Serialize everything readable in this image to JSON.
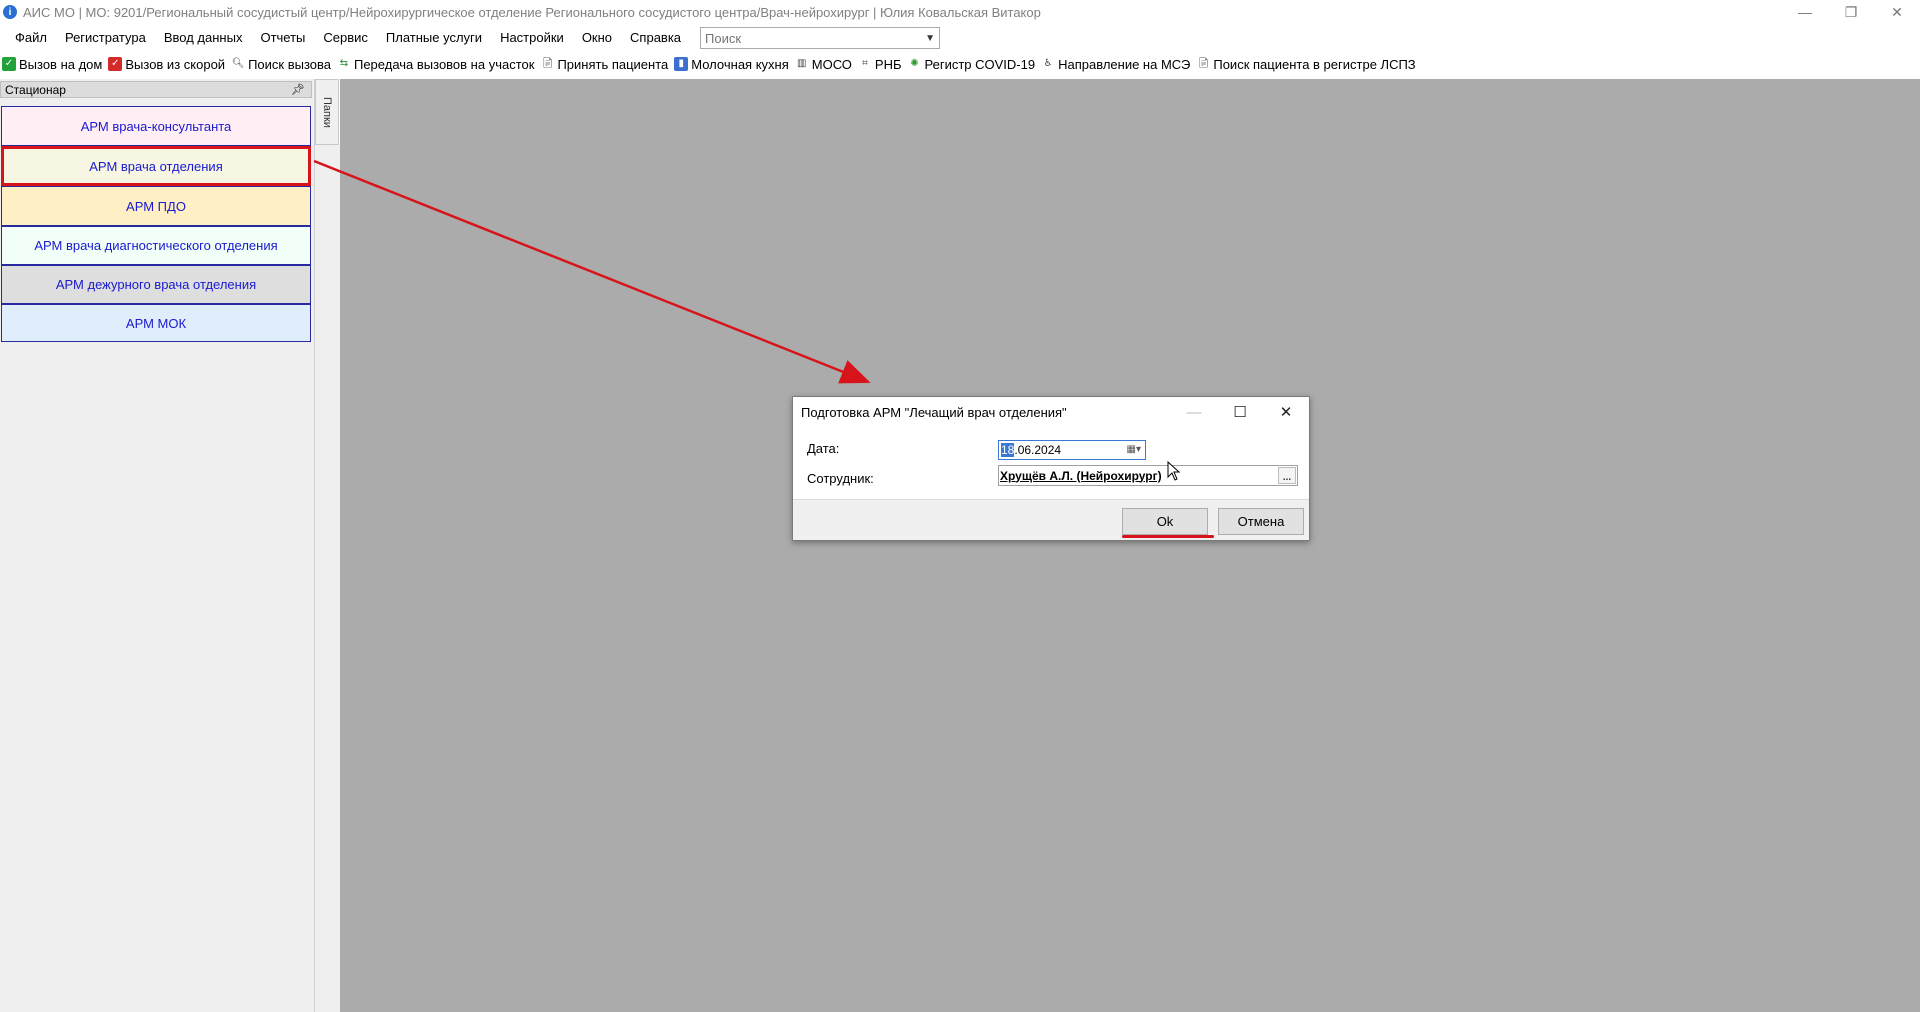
{
  "window": {
    "title": "АИС МО | МО: 9201/Региональный сосудистый центр/Нейрохирургическое отделение Регионального сосудистого центра/Врач-нейрохирург | Юлия Ковальская Витакор",
    "minimize": "—",
    "restore": "❐",
    "close": "✕"
  },
  "menu": {
    "items": [
      "Файл",
      "Регистратура",
      "Ввод данных",
      "Отчеты",
      "Сервис",
      "Платные услуги",
      "Настройки",
      "Окно",
      "Справка"
    ],
    "search_placeholder": "Поиск"
  },
  "toolbar": {
    "items": [
      {
        "label": "Вызов на дом",
        "icon": "check-green-icon"
      },
      {
        "label": "Вызов из скорой",
        "icon": "check-red-icon"
      },
      {
        "label": "Поиск вызова",
        "icon": "search-icon"
      },
      {
        "label": "Передача вызовов на участок",
        "icon": "transfer-icon"
      },
      {
        "label": "Принять пациента",
        "icon": "document-icon"
      },
      {
        "label": "Молочная кухня",
        "icon": "bottle-icon"
      },
      {
        "label": "МОСО",
        "icon": "building-icon"
      },
      {
        "label": "РНБ",
        "icon": "tag-icon"
      },
      {
        "label": "Регистр COVID-19",
        "icon": "virus-icon"
      },
      {
        "label": "Направление на МСЭ",
        "icon": "wheelchair-icon"
      },
      {
        "label": "Поиск пациента в регистре ЛСПЗ",
        "icon": "document-icon"
      }
    ]
  },
  "left_panel": {
    "header": "Стационар",
    "side_tab": "Папки",
    "arm_items": [
      {
        "label": "АРМ врача-консультанта",
        "bg": "#ffeef4"
      },
      {
        "label": "АРМ врача отделения",
        "bg": "#f6f6e2"
      },
      {
        "label": "АРМ ПДО",
        "bg": "#ffefc5"
      },
      {
        "label": "АРМ врача диагностического отделения",
        "bg": "#f2fff8"
      },
      {
        "label": "АРМ дежурного врача отделения",
        "bg": "#dedede"
      },
      {
        "label": "АРМ МОК",
        "bg": "#e0eefb"
      }
    ]
  },
  "dialog": {
    "title": "Подготовка АРМ \"Лечащий врач отделения\"",
    "minimize": "—",
    "maximize": "☐",
    "close": "✕",
    "date_label": "Дата:",
    "date_value_selected": "18",
    "date_value_rest": ".06.2024",
    "employee_label": "Сотрудник:",
    "employee_value": "Хрущёв А.Л. (Нейрохирург)",
    "browse": "...",
    "ok": "Ok",
    "cancel": "Отмена"
  },
  "colors": {
    "highlight_red": "#d7141a",
    "arm_text": "#1a1ad0",
    "workspace": "#ababab"
  }
}
